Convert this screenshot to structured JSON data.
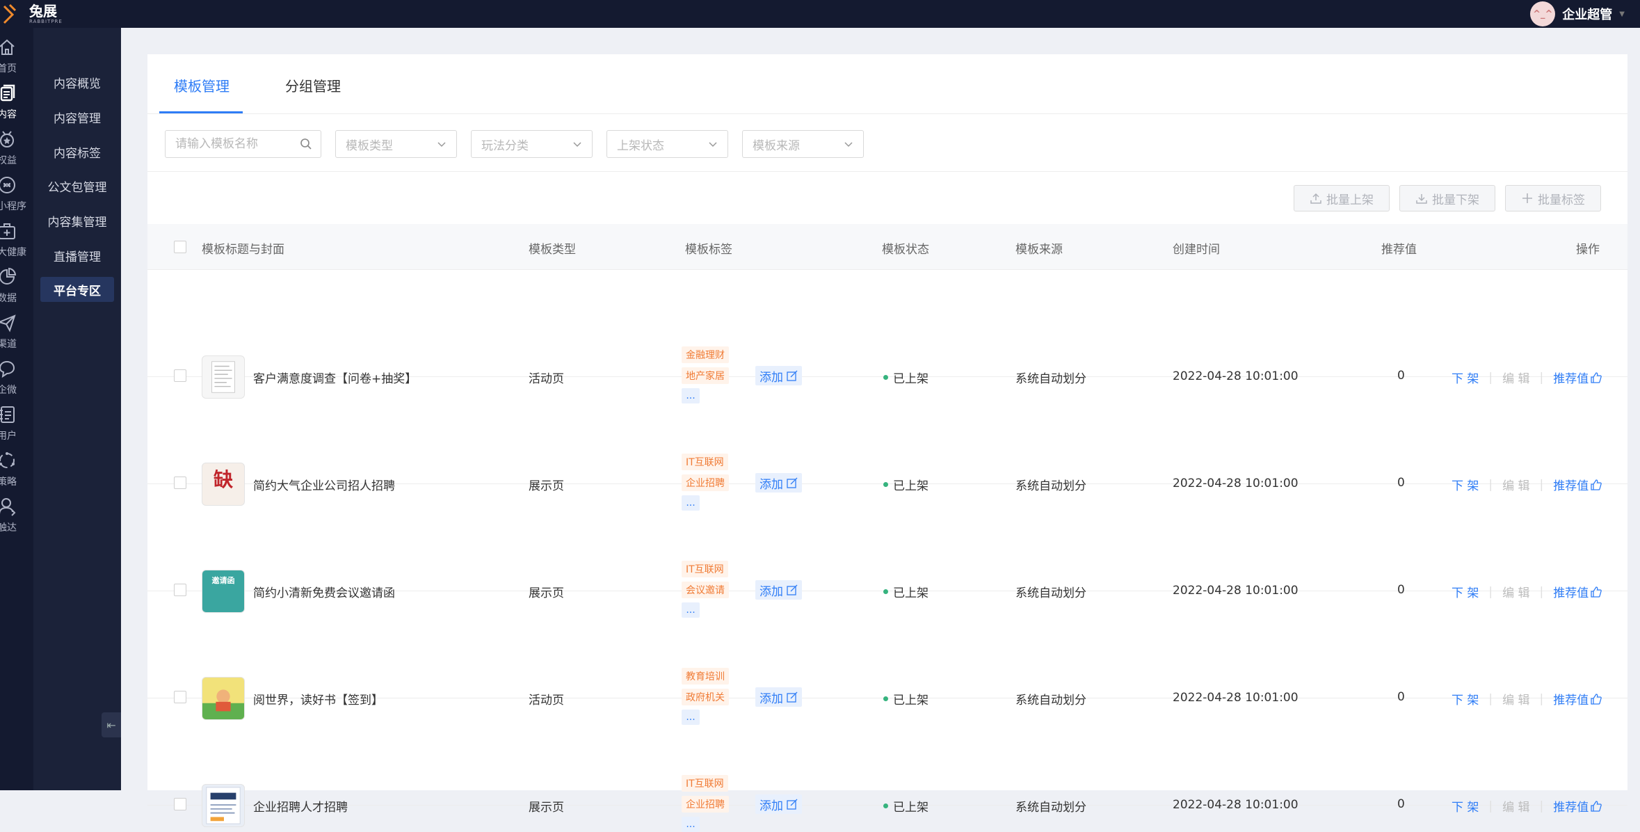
{
  "app": {
    "brand_name": "兔展",
    "brand_en": "RABBITPRE",
    "user_name": "企业超管",
    "avatar_text": "^_^"
  },
  "iconbar": [
    {
      "label": "首页",
      "icon": "home-icon"
    },
    {
      "label": "内容",
      "icon": "document-icon",
      "active": true
    },
    {
      "label": "权益",
      "icon": "medal-icon"
    },
    {
      "label": "小程序",
      "icon": "link-icon"
    },
    {
      "label": "大健康",
      "icon": "medkit-icon"
    },
    {
      "label": "数据",
      "icon": "pie-chart-icon"
    },
    {
      "label": "渠道",
      "icon": "paper-plane-icon"
    },
    {
      "label": "企微",
      "icon": "chat-icon"
    },
    {
      "label": "用户",
      "icon": "contacts-icon"
    },
    {
      "label": "策略",
      "icon": "cycle-icon"
    },
    {
      "label": "触达",
      "icon": "user-icon"
    }
  ],
  "subnav": [
    {
      "label": "内容概览"
    },
    {
      "label": "内容管理"
    },
    {
      "label": "内容标签"
    },
    {
      "label": "公文包管理"
    },
    {
      "label": "内容集管理"
    },
    {
      "label": "直播管理"
    },
    {
      "label": "平台专区",
      "active": true
    }
  ],
  "collapse_glyph": "⇤",
  "tabs": [
    {
      "label": "模板管理",
      "active": true
    },
    {
      "label": "分组管理"
    }
  ],
  "filters": {
    "search_placeholder": "请输入模板名称",
    "type": "模板类型",
    "play": "玩法分类",
    "status": "上架状态",
    "source": "模板来源"
  },
  "batch": {
    "on_shelf": "批量上架",
    "off_shelf": "批量下架",
    "tag": "批量标签"
  },
  "columns": {
    "title": "模板标题与封面",
    "type": "模板类型",
    "tags": "模板标签",
    "status": "模板状态",
    "source": "模板来源",
    "created": "创建时间",
    "score": "推荐值",
    "ops": "操作"
  },
  "row_labels": {
    "add": "添加",
    "more": "...",
    "off": "下 架",
    "edit": "编 辑",
    "recommend": "推荐值"
  },
  "rows": [
    {
      "title": "客户满意度调查【问卷+抽奖】",
      "type": "活动页",
      "tags": [
        "金融理财",
        "地产家居"
      ],
      "status": "已上架",
      "source": "系统自动划分",
      "created": "2022-04-28 10:01:00",
      "score": "0",
      "thumb": "doc"
    },
    {
      "title": "简约大气企业公司招人招聘",
      "type": "展示页",
      "tags": [
        "IT互联网",
        "企业招聘"
      ],
      "status": "已上架",
      "source": "系统自动划分",
      "created": "2022-04-28 10:01:00",
      "score": "0",
      "thumb": "recruit",
      "thumb_text": "缺"
    },
    {
      "title": "简约小清新免费会议邀请函",
      "type": "展示页",
      "tags": [
        "IT互联网",
        "会议邀请"
      ],
      "status": "已上架",
      "source": "系统自动划分",
      "created": "2022-04-28 10:01:00",
      "score": "0",
      "thumb": "invite",
      "thumb_text": "邀请函"
    },
    {
      "title": "阅世界，读好书【签到】",
      "type": "活动页",
      "tags": [
        "教育培训",
        "政府机关"
      ],
      "status": "已上架",
      "source": "系统自动划分",
      "created": "2022-04-28 10:01:00",
      "score": "0",
      "thumb": "reading"
    },
    {
      "title": "企业招聘人才招聘",
      "type": "展示页",
      "tags": [
        "IT互联网",
        "企业招聘"
      ],
      "status": "已上架",
      "source": "系统自动划分",
      "created": "2022-04-28 10:01:00",
      "score": "0",
      "thumb": "talent"
    }
  ],
  "colors": {
    "accent": "#2f7df6",
    "tag_text": "#f07b35",
    "tag_bg": "#fff3ea",
    "nav_bg": "#141a30",
    "status_dot": "#36b37e"
  }
}
